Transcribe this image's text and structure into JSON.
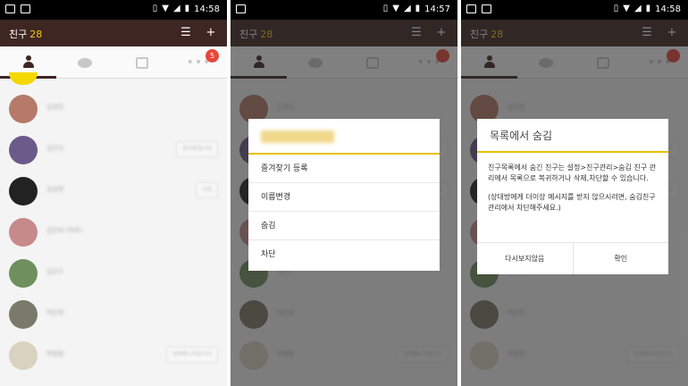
{
  "screens": [
    {
      "status": {
        "time": "14:58"
      },
      "appbar": {
        "title": "친구",
        "count": "28",
        "sort_icon": "sort-icon",
        "add_icon": "add-friend-icon"
      },
      "tabs": [
        {
          "name": "tab-friends",
          "icon": "person-icon",
          "active": true
        },
        {
          "name": "tab-chats",
          "icon": "chat-bubble-icon"
        },
        {
          "name": "tab-channel",
          "icon": "news-icon"
        },
        {
          "name": "tab-more",
          "icon": "more-icon",
          "badge": "5"
        }
      ],
      "friends": [
        {
          "name": "김영민",
          "status": "",
          "color": "#b57a6a"
        },
        {
          "name": "김은지",
          "status": "생각중입니다",
          "color": "#6b5a8a"
        },
        {
          "name": "김성현",
          "status": "사랑",
          "color": "#222222"
        },
        {
          "name": "김은비 (하루)",
          "status": "",
          "color": "#c78a8a"
        },
        {
          "name": "김은수",
          "status": "",
          "color": "#6f8f5f"
        },
        {
          "name": "박은정",
          "status": "",
          "color": "#7a7a6a"
        },
        {
          "name": "박범철",
          "status": "상태메시지입니다",
          "color": "#d9d2c0"
        }
      ]
    },
    {
      "status": {
        "time": "14:57"
      },
      "menu": {
        "items": [
          "즐겨찾기 등록",
          "이름변경",
          "숨김",
          "차단"
        ]
      }
    },
    {
      "status": {
        "time": "14:58"
      },
      "dialog": {
        "title": "목록에서 숨김",
        "body1": "친구목록에서 숨긴 친구는 설정>친구관리>숨김 친구 관리에서 목록으로 복귀하거나 삭제,차단할 수 있습니다.",
        "body2": "(상대방에게 더이상 메시지를 받지 않으시려면, 숨김친구관리에서 차단해주세요.)",
        "cancel": "다시보지않음",
        "ok": "확인"
      }
    }
  ],
  "colors": {
    "appbar": "#3e2723",
    "accent": "#f5c518",
    "badge": "#e8473a",
    "divider": "#e8c000"
  }
}
